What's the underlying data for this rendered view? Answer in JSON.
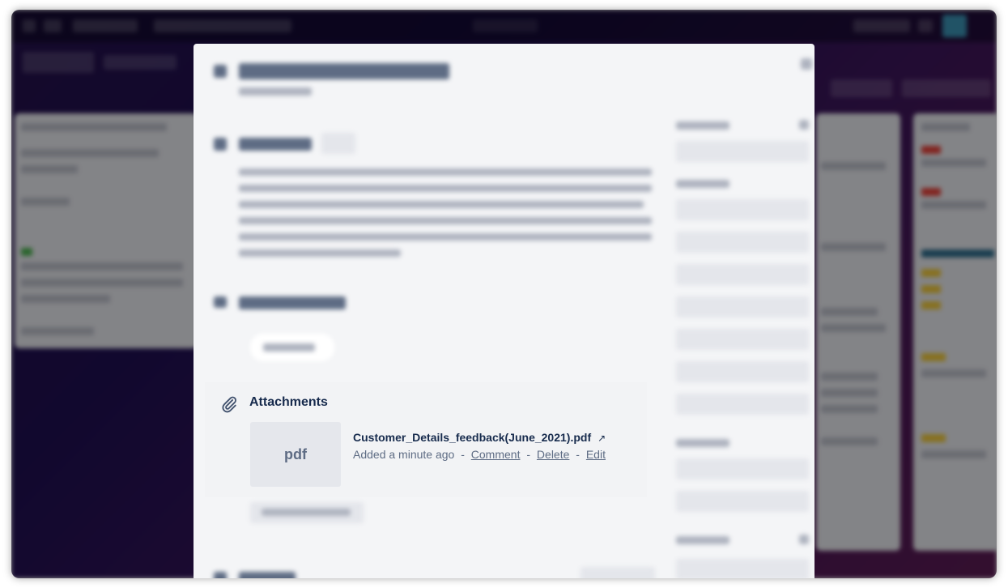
{
  "attachments": {
    "title": "Attachments",
    "file": {
      "name": "Customer_Details_feedback(June_2021).pdf",
      "type_label": "pdf",
      "added": "Added a minute ago",
      "separator": "-",
      "actions": [
        "Comment",
        "Delete",
        "Edit"
      ]
    }
  },
  "icons": {
    "attachment": "paperclip-icon",
    "open_external": "arrow-up-right-icon"
  },
  "colors": {
    "board_background": "#24104a",
    "modal_background": "#f4f5f7",
    "text_primary": "#172b4d",
    "text_secondary": "#5e6c84"
  }
}
